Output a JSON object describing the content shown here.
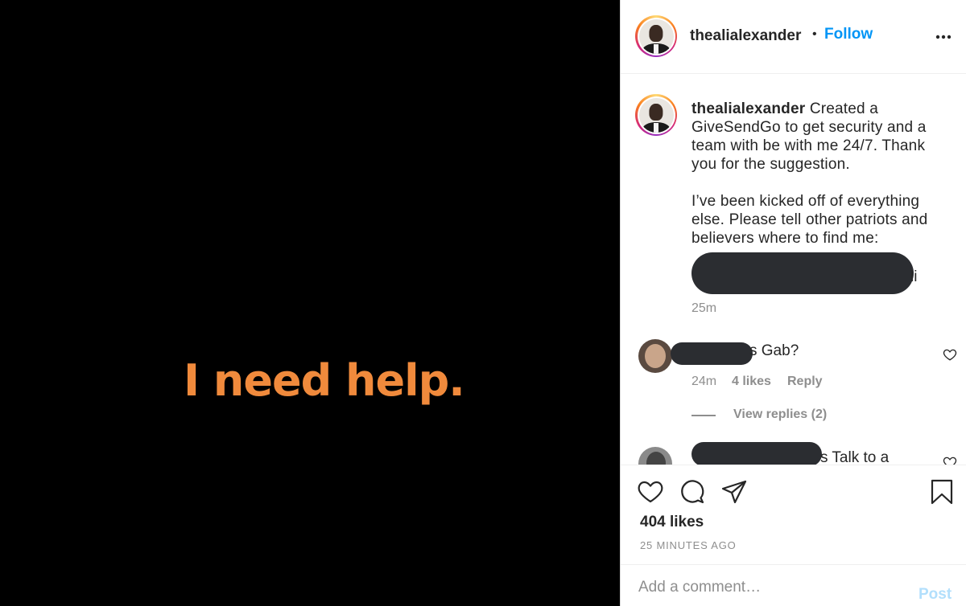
{
  "media": {
    "text": "I need help."
  },
  "header": {
    "username": "thealialexander",
    "separator": "•",
    "follow_label": "Follow"
  },
  "caption": {
    "username": "thealialexander",
    "paragraph1": " Created a GiveSendGo to get security and a team with be with me 24/7. Thank you for the suggestion.",
    "paragraph2": "I’ve been kicked off of everything else. Please tell other patriots and believers where to find me:",
    "link_tail": "li",
    "time": "25m"
  },
  "comments": [
    {
      "text_tail": "s Gab?",
      "time": "24m",
      "likes": "4 likes",
      "reply_label": "Reply",
      "view_replies": "View replies (2)"
    },
    {
      "text_tail": "s Talk to a"
    }
  ],
  "actions": {
    "likes": "404 likes",
    "time_ago": "25 MINUTES AGO"
  },
  "add_comment": {
    "placeholder": "Add a comment…",
    "post_label": "Post"
  },
  "colors": {
    "follow_blue": "#0095f6",
    "post_disabled": "#b2dffc",
    "media_text_orange": "#f08a3c",
    "redaction": "#2b2d31"
  },
  "icons": [
    "more-icon",
    "heart-icon",
    "comment-icon",
    "share-icon",
    "bookmark-icon"
  ]
}
